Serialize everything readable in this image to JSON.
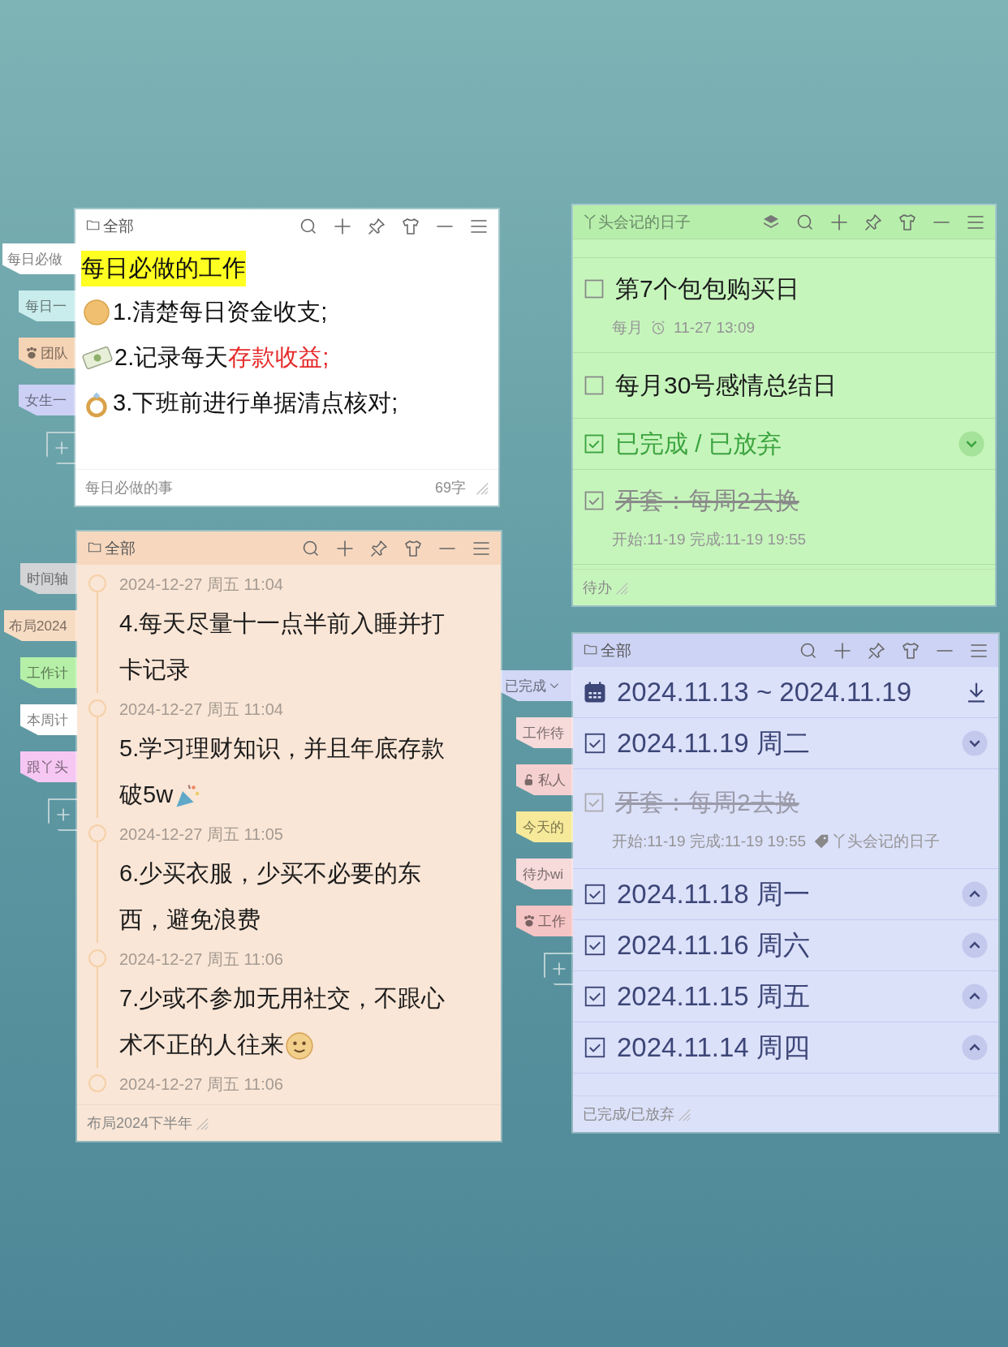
{
  "tab_groups": [
    {
      "tabs": [
        {
          "label": "每日必做",
          "kind": "plain",
          "color": "#ffffff",
          "selected": true
        },
        {
          "label": "每日一",
          "kind": "plain",
          "color": "#c9ecec",
          "selected": false
        },
        {
          "label": "团队",
          "kind": "paw",
          "color": "#f5d3b5",
          "selected": false
        },
        {
          "label": "女生一",
          "kind": "plain",
          "color": "#cdd0f5",
          "selected": false
        }
      ]
    },
    {
      "tabs": [
        {
          "label": "时间轴",
          "kind": "plain",
          "color": "#d2d4d6",
          "selected": false
        },
        {
          "label": "布局2024",
          "kind": "plain",
          "color": "#f7dcc4",
          "selected": true
        },
        {
          "label": "工作计",
          "kind": "plain",
          "color": "#b6f0a8",
          "selected": false
        },
        {
          "label": "本周计",
          "kind": "plain",
          "color": "#ffffff",
          "selected": false
        },
        {
          "label": "跟丫头",
          "kind": "plain",
          "color": "#f6c7f3",
          "selected": false
        }
      ]
    },
    {
      "tabs": [
        {
          "label": "已完成",
          "kind": "dropdown",
          "color": "#d2d8f6",
          "selected": true
        },
        {
          "label": "工作待",
          "kind": "plain",
          "color": "#f7dada",
          "selected": false
        },
        {
          "label": "私人",
          "kind": "lock",
          "color": "#f5d0d0",
          "selected": false
        },
        {
          "label": "今天的",
          "kind": "plain",
          "color": "#f6ea9a",
          "selected": false
        },
        {
          "label": "待办wi",
          "kind": "plain",
          "color": "#f7dada",
          "selected": false
        },
        {
          "label": "工作",
          "kind": "paw",
          "color": "#f5c4c4",
          "selected": false
        }
      ]
    }
  ],
  "notes": [
    {
      "kind": "text",
      "folder": "全部",
      "title": "每日必做的工作",
      "lines": [
        {
          "kind": "coin",
          "parts": [
            {
              "text": "1.清楚每日资金收支;",
              "emphasis": false
            }
          ]
        },
        {
          "kind": "cash",
          "parts": [
            {
              "text": "2.记录每天",
              "emphasis": false
            },
            {
              "text": "存款收益;",
              "emphasis": true
            }
          ]
        },
        {
          "kind": "ring",
          "parts": [
            {
              "text": "3.下班前进行单据清点核对;",
              "emphasis": false
            }
          ]
        }
      ],
      "footer": "每日必做的事",
      "count": "69字"
    },
    {
      "kind": "timeline",
      "folder": "全部",
      "entries": [
        {
          "time": "2024-12-27 周五 11:04",
          "text": "4.每天尽量十一点半前入睡并打卡记录",
          "kind": "plain"
        },
        {
          "time": "2024-12-27 周五 11:04",
          "text": "5.学习理财知识，并且年底存款破5w",
          "kind": "party"
        },
        {
          "time": "2024-12-27 周五 11:05",
          "text": "6.少买衣服，少买不必要的东西，避免浪费",
          "kind": "plain"
        },
        {
          "time": "2024-12-27 周五 11:06",
          "text": "7.少或不参加无用社交，不跟心术不正的人往来",
          "kind": "smile"
        },
        {
          "time": "2024-12-27 周五 11:06"
        }
      ],
      "footer": "布局2024下半年"
    },
    {
      "kind": "todo",
      "title": "丫头会记的日子",
      "items": [
        {
          "kind": "task",
          "text": "第7个包包购买日",
          "checked": false,
          "repeat": "每月",
          "reminder": "11-27 13:09"
        },
        {
          "kind": "task",
          "text": "每月30号感情总结日",
          "checked": false
        },
        {
          "kind": "section",
          "text": "已完成 / 已放弃",
          "expanded": true
        },
        {
          "kind": "task",
          "text": "牙套：每周2去换",
          "checked": true,
          "meta": "开始:11-19 完成:11-19 19:55"
        }
      ],
      "footer": "待办"
    },
    {
      "kind": "week",
      "folder": "全部",
      "range": "2024.11.13 ~ 2024.11.19",
      "days": [
        {
          "label": "2024.11.19 周二",
          "expanded": true,
          "items": [
            {
              "text": "牙套：每周2去换",
              "checked": true,
              "meta": "开始:11-19 完成:11-19 19:55",
              "tag": "丫头会记的日子"
            }
          ]
        },
        {
          "label": "2024.11.18 周一",
          "expanded": false
        },
        {
          "label": "2024.11.16 周六",
          "expanded": false
        },
        {
          "label": "2024.11.15 周五",
          "expanded": false
        },
        {
          "label": "2024.11.14 周四",
          "expanded": false
        }
      ],
      "footer": "已完成/已放弃"
    }
  ]
}
